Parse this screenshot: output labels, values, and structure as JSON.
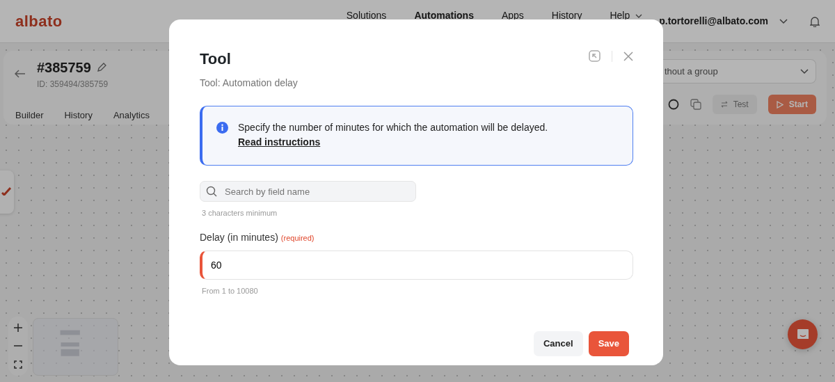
{
  "header": {
    "logo": "albato",
    "nav": [
      {
        "label": "Solutions",
        "selected": false,
        "dropdown": false
      },
      {
        "label": "Automations",
        "selected": true,
        "dropdown": false
      },
      {
        "label": "Apps",
        "selected": false,
        "dropdown": false
      },
      {
        "label": "History",
        "selected": false,
        "dropdown": false
      },
      {
        "label": "Help",
        "selected": false,
        "dropdown": true
      }
    ],
    "user": "p.tortorelli@albato.com"
  },
  "automation": {
    "title": "#385759",
    "id": "ID: 359494/385759",
    "tabs": [
      {
        "label": "Builder",
        "selected": false
      },
      {
        "label": "History",
        "selected": false
      },
      {
        "label": "Analytics",
        "selected": false
      }
    ],
    "group": "thout a group",
    "test_button": "Test",
    "start_button": "Start"
  },
  "modal": {
    "title": "Tool",
    "subtitle": "Tool: Automation delay",
    "info": {
      "text": "Specify the number of minutes for which the automation will be delayed.",
      "link": "Read instructions"
    },
    "search": {
      "placeholder": "Search by field name",
      "hint": "3 characters minimum"
    },
    "field": {
      "label": "Delay (in minutes)",
      "required": "(required)",
      "value": "60",
      "hint": "From 1 to 10080"
    },
    "buttons": [
      {
        "label": "Cancel",
        "kind": "secondary"
      },
      {
        "label": "Save",
        "kind": "primary"
      }
    ]
  }
}
